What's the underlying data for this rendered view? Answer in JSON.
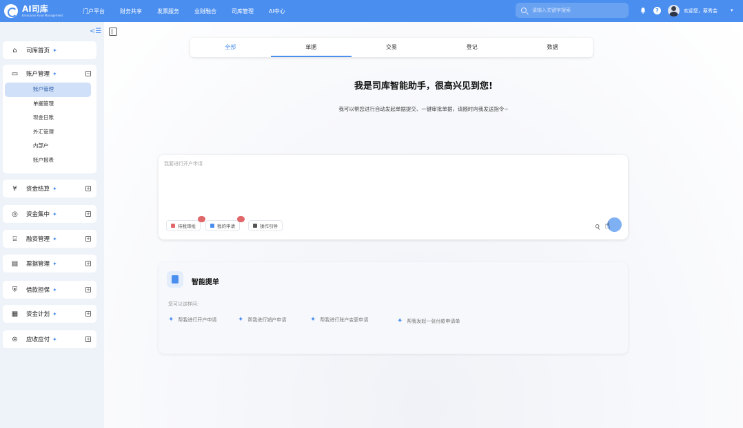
{
  "app": {
    "title": "AI司库",
    "subtitle": "Enterprise Fund Management"
  },
  "topnav": [
    "门户平台",
    "财务共享",
    "发票服务",
    "业财融合",
    "司库管理",
    "AI中心"
  ],
  "search": {
    "placeholder": "请输入关键字搜索"
  },
  "user": {
    "welcome": "欢迎您，蔡秀芸"
  },
  "sidebar": {
    "home": "司库首页",
    "account": {
      "label": "账户管理",
      "items": [
        "账户管理",
        "单据管理",
        "现金日账",
        "外汇管理",
        "内部户",
        "账户报表"
      ],
      "active_index": 0
    },
    "groups": [
      "资金结算",
      "资金集中",
      "融资管理",
      "票据管理",
      "借款担保",
      "资金计划",
      "应收应付"
    ]
  },
  "tabs": [
    "全部",
    "单据",
    "交易",
    "登记",
    "数据"
  ],
  "greeting": {
    "headline": "我是司库智能助手，很高兴见到您!",
    "subline": "我可以帮您进行自动发起单据提交、一键审批单据，请随时向我发送指令~"
  },
  "chat": {
    "placeholder": "我要进行开户申请",
    "chips": [
      "待我审批",
      "我的申请",
      "操作引导"
    ]
  },
  "smart": {
    "title": "智能提单",
    "hint": "您可以这样问:",
    "suggestions": [
      "帮我进行开户申请",
      "帮我进行销户申请",
      "帮我进行账户变更申请",
      "帮我发起一张付款申请单"
    ]
  },
  "colors": {
    "primary": "#4a8ef0",
    "badge": "#e0686a",
    "active_bg": "#cfe0f8"
  }
}
